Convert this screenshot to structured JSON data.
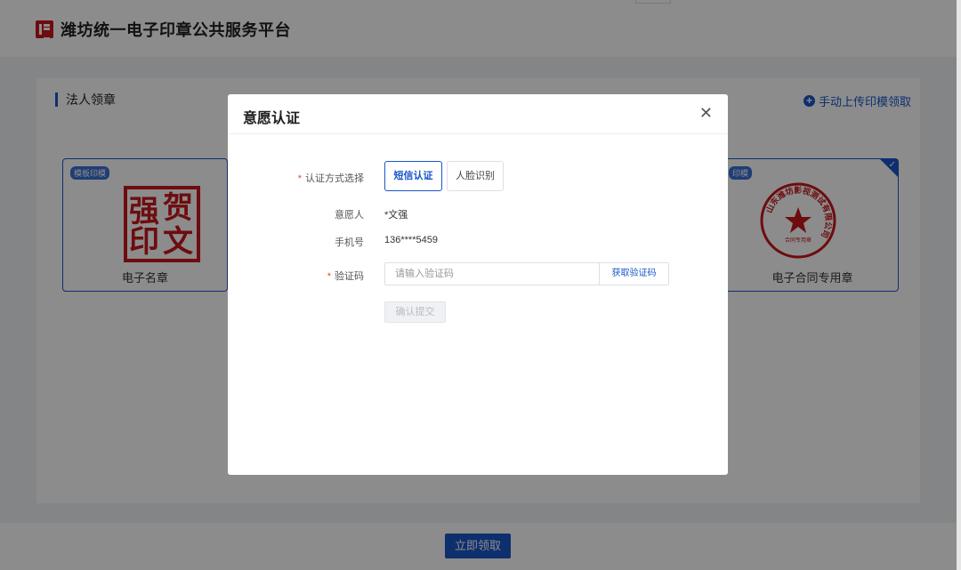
{
  "header": {
    "title": "潍坊统一电子印章公共服务平台",
    "logo_icon": "logo-icon"
  },
  "section": {
    "title": "法人领章",
    "upload_link": "手动上传印模领取"
  },
  "seals": {
    "left": {
      "tag": "模板印模",
      "name": "电子名章",
      "chars": [
        "强",
        "贺",
        "印",
        "文"
      ]
    },
    "right": {
      "tag": "印模",
      "name": "电子合同专用章",
      "ring_text": "山东潍坊影视测试有限公司",
      "inner_text": "合同专用章"
    }
  },
  "footer": {
    "claim_button": "立即领取"
  },
  "modal": {
    "title": "意愿认证",
    "close_icon": "close-icon",
    "method": {
      "label": "认证方式选择",
      "options": [
        "短信认证",
        "人脸识别"
      ],
      "selected": "短信认证"
    },
    "applicant": {
      "label": "意愿人",
      "value": "*文强"
    },
    "phone": {
      "label": "手机号",
      "value": "136****5459"
    },
    "code": {
      "label": "验证码",
      "placeholder": "请输入验证码",
      "get_code": "获取验证码"
    },
    "submit": "确认提交"
  },
  "colors": {
    "primary": "#1a56c9",
    "seal_red": "#c8161d"
  }
}
